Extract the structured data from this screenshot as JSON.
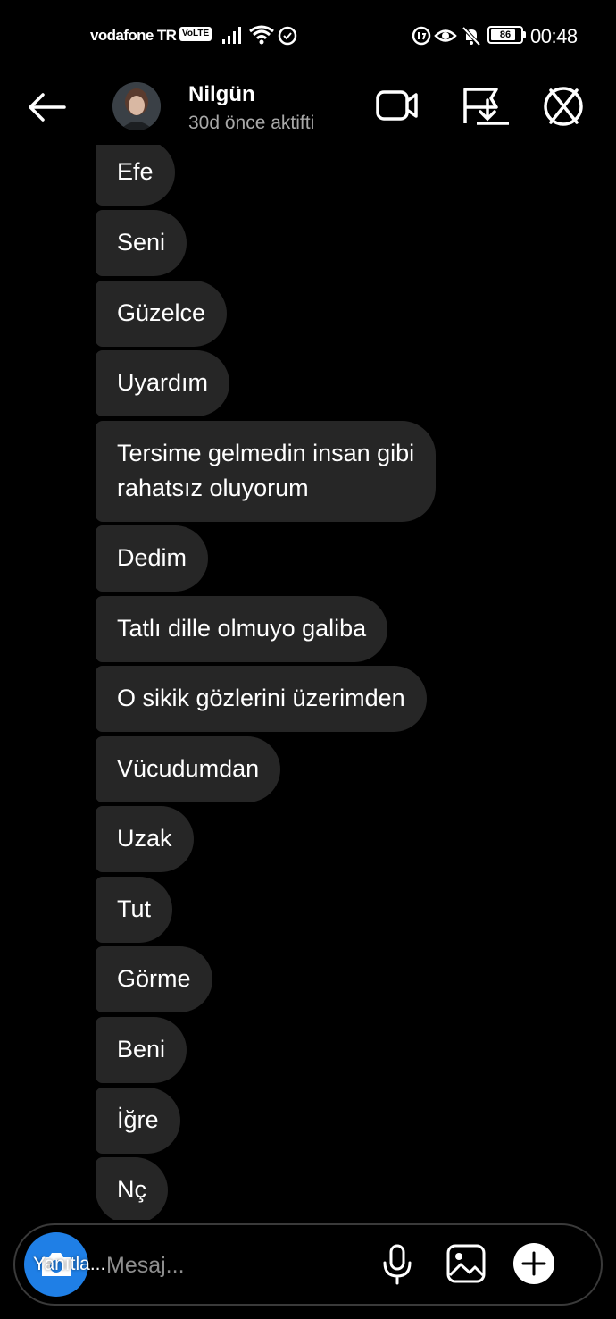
{
  "status_bar": {
    "carrier": "vodafone TR",
    "volte": "VoLTE",
    "battery": "86",
    "battery_level": 0.86,
    "time": "00:48"
  },
  "header": {
    "name": "Nilgün",
    "subtitle": "30d önce aktifti"
  },
  "messages": [
    "Efe",
    "Seni",
    "Güzelce",
    "Uyardım",
    "Tersime gelmedin insan gibi\nrahatsız oluyorum",
    "Dedim",
    "Tatlı dille olmuyo galiba",
    "O sikik gözlerini üzerimden",
    "Vücudumdan",
    "Uzak",
    "Tut",
    "Görme",
    "Beni",
    "İğre",
    "Nç"
  ],
  "composer": {
    "placeholder": "Mesaj...",
    "tooltip": "Yanıtla..."
  },
  "colors": {
    "background": "#000000",
    "bubble": "#262626",
    "camera_button": "#1f7fe6",
    "secondary_text": "#a8a8a8"
  },
  "icons": [
    "back-arrow-icon",
    "video-call-icon",
    "flag-download-icon",
    "cancel-circle-icon",
    "camera-icon",
    "microphone-icon",
    "gallery-icon",
    "plus-icon"
  ]
}
